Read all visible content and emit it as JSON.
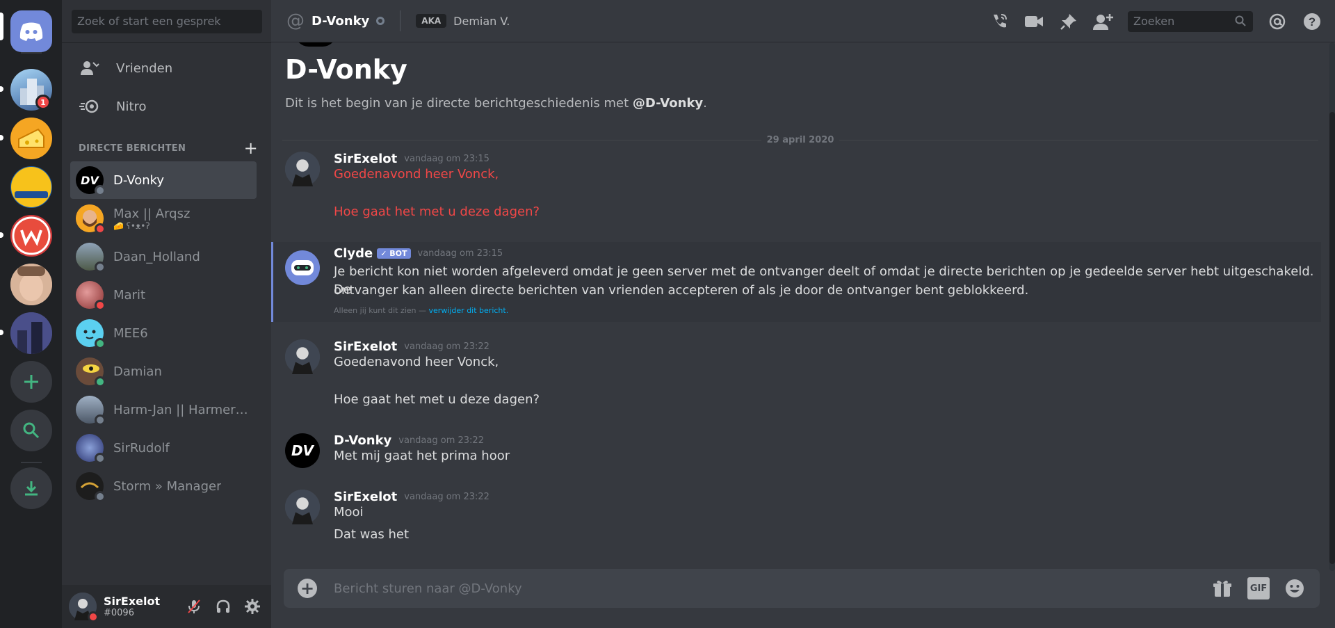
{
  "colors": {
    "online": "#43b581",
    "dnd": "#f04747",
    "offline": "#747f8d",
    "blurple": "#7289da"
  },
  "sidebar": {
    "search_placeholder": "Zoek of start een gesprek",
    "nav": [
      {
        "label": "Vrienden",
        "icon": "friends-icon"
      },
      {
        "label": "Nitro",
        "icon": "nitro-icon"
      }
    ],
    "dm_header": "DIRECTE BERICHTEN",
    "dms": [
      {
        "name": "D-Vonky",
        "status": "offline",
        "active": true
      },
      {
        "name": "Max || Arqsz",
        "sub": "🧀 ʕ•ᴥ•ʔ",
        "status": "dnd"
      },
      {
        "name": "Daan_Holland",
        "status": "offline"
      },
      {
        "name": "Marit",
        "status": "dnd"
      },
      {
        "name": "MEE6",
        "status": "online"
      },
      {
        "name": "Damian",
        "status": "online"
      },
      {
        "name": "Harm-Jan || Harmer2...",
        "status": "offline"
      },
      {
        "name": "SirRudolf",
        "status": "offline"
      },
      {
        "name": "Storm » Manager",
        "status": "offline"
      }
    ]
  },
  "rail": {
    "badge_count": "1"
  },
  "user": {
    "name": "SirExelot",
    "tag": "#0096"
  },
  "header": {
    "title": "D-Vonky",
    "aka_label": "AKA",
    "aka_name": "Demian V.",
    "search_placeholder": "Zoeken"
  },
  "chat": {
    "intro_title": "D-Vonky",
    "intro_text": "Dit is het begin van je directe berichtgeschiedenis met ",
    "intro_mention": "@D-Vonky",
    "intro_end": ".",
    "date_divider": "29 april 2020",
    "messages": [
      {
        "author": "SirExelot",
        "time": "vandaag om 23:15",
        "lines": [
          "Goedenavond heer Vonck,",
          "Hoe gaat het met u deze dagen?"
        ]
      },
      {
        "author": "Clyde",
        "badge": "✓ BOT",
        "time": "vandaag om 23:15",
        "lines": [
          "Je bericht kon niet worden afgeleverd omdat je geen server met de ontvanger deelt of omdat je directe berichten op je gedeelde server hebt uitgeschakeld. De",
          "ontvanger kan alleen directe berichten van vrienden accepteren of als je door de ontvanger bent geblokkeerd."
        ],
        "note": "Alleen jij kunt dit zien — ",
        "note_link": "verwijder dit bericht."
      },
      {
        "author": "SirExelot",
        "time": "vandaag om 23:22",
        "lines": [
          "Goedenavond heer Vonck,",
          "Hoe gaat het met u deze dagen?"
        ]
      },
      {
        "author": "D-Vonky",
        "time": "vandaag om 23:22",
        "lines": [
          "Met mij gaat het prima hoor"
        ]
      },
      {
        "author": "SirExelot",
        "time": "vandaag om 23:22",
        "lines": [
          "Mooi",
          "Dat was het"
        ]
      }
    ]
  },
  "composer": {
    "placeholder": "Bericht sturen naar @D-Vonky",
    "gif_label": "GIF"
  }
}
